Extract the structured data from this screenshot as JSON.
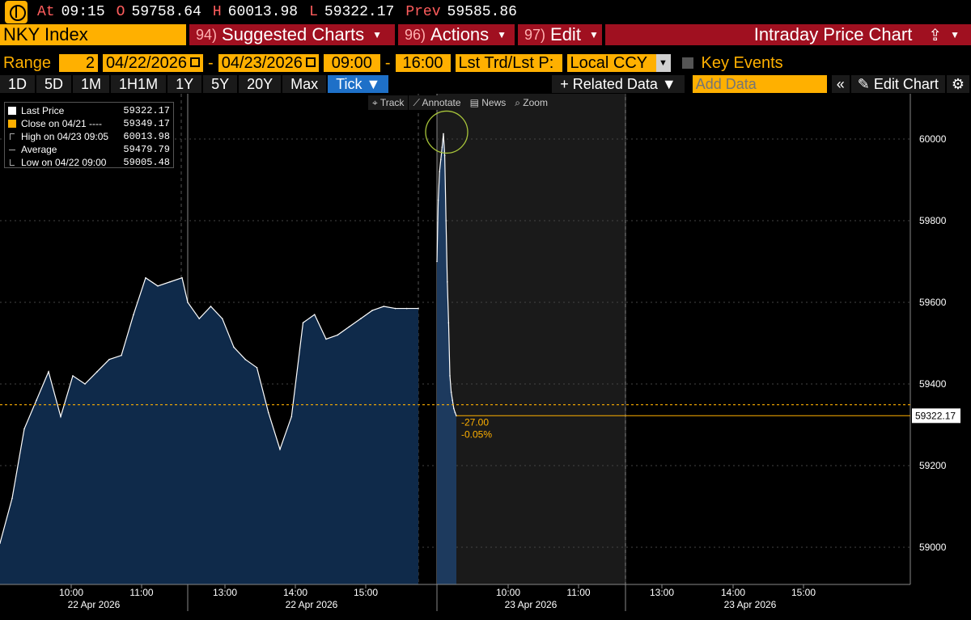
{
  "quote": {
    "at_label": "At",
    "at_value": "09:15",
    "o_label": "O",
    "o_value": "59758.64",
    "h_label": "H",
    "h_value": "60013.98",
    "l_label": "L",
    "l_value": "59322.17",
    "prev_label": "Prev",
    "prev_value": "59585.86"
  },
  "header": {
    "ticker": "NKY Index",
    "menus": [
      {
        "num": "94)",
        "label": "Suggested Charts"
      },
      {
        "num": "96)",
        "label": "Actions"
      },
      {
        "num": "97)",
        "label": "Edit"
      }
    ],
    "title": "Intraday Price Chart"
  },
  "range": {
    "label": "Range",
    "days": "2",
    "start_date": "04/22/2026",
    "end_date": "04/23/2026",
    "start_time": "09:00",
    "end_time": "16:00",
    "field": "Lst Trd/Lst P:",
    "currency": "Local CCY",
    "key_events": "Key Events"
  },
  "periods": [
    "1D",
    "5D",
    "1M",
    "1H1M",
    "1Y",
    "5Y",
    "20Y",
    "Max"
  ],
  "period_active": "Tick ▼",
  "toolbar": {
    "related_data": "+ Related Data ▼",
    "add_data_placeholder": "Add Data",
    "edit_chart": "Edit Chart"
  },
  "chart_tools": [
    "⌖ Track",
    "⟋ Annotate",
    "▤ News",
    "⌕ Zoom"
  ],
  "legend": [
    {
      "label": "Last Price",
      "value": "59322.17"
    },
    {
      "label": "Close on 04/21 ----",
      "value": "59349.17"
    },
    {
      "label": "High on 04/23 09:05",
      "value": "60013.98"
    },
    {
      "label": "Average",
      "value": "59479.79"
    },
    {
      "label": "Low on 04/22 09:00",
      "value": "59005.48"
    }
  ],
  "colors": {
    "orange": "#ffb000",
    "area_fill": "#0f2a4a",
    "area_fill_light": "#1d3a5e",
    "line": "#ffffff",
    "grid": "#444444",
    "circle": "#a8c53a"
  },
  "chart_data": {
    "type": "area",
    "title": "Intraday Price Chart",
    "ylim": [
      58900,
      60100
    ],
    "y_ticks": [
      59000,
      59200,
      59400,
      59600,
      59800,
      60000
    ],
    "x_tick_labels": [
      "10:00",
      "11:00",
      "13:00",
      "14:00",
      "15:00",
      "10:00",
      "11:00",
      "13:00",
      "14:00",
      "15:00"
    ],
    "x_date_labels": [
      "22 Apr 2026",
      "22 Apr 2026",
      "23 Apr 2026",
      "23 Apr 2026"
    ],
    "previous_close": 59349.17,
    "last_price": 59322.17,
    "last_price_label": "59322.17",
    "change_label": "-27.00",
    "change_pct_label": "-0.05%",
    "series": [
      {
        "session": "22 Apr 2026",
        "x": [
          "09:00",
          "09:10",
          "09:20",
          "09:30",
          "09:40",
          "09:50",
          "10:00",
          "10:10",
          "10:20",
          "10:30",
          "10:40",
          "10:50",
          "11:00",
          "11:10",
          "11:20",
          "11:30",
          "12:30",
          "12:40",
          "12:50",
          "13:00",
          "13:10",
          "13:20",
          "13:30",
          "13:40",
          "13:50",
          "14:00",
          "14:10",
          "14:20",
          "14:30",
          "14:40",
          "14:50",
          "15:00",
          "15:10",
          "15:20",
          "15:30",
          "15:40",
          "15:50"
        ],
        "values": [
          59010,
          59120,
          59290,
          59360,
          59430,
          59320,
          59420,
          59400,
          59430,
          59460,
          59470,
          59570,
          59660,
          59640,
          59650,
          59660,
          59600,
          59560,
          59590,
          59560,
          59490,
          59460,
          59440,
          59330,
          59240,
          59320,
          59550,
          59570,
          59510,
          59520,
          59540,
          59560,
          59580,
          59590,
          59585,
          59585,
          59585
        ]
      },
      {
        "session": "23 Apr 2026",
        "x": [
          "09:00",
          "09:01",
          "09:02",
          "09:03",
          "09:04",
          "09:05",
          "09:06",
          "09:07",
          "09:08",
          "09:09",
          "09:10",
          "09:11",
          "09:12",
          "09:13",
          "09:14",
          "09:15"
        ],
        "values": [
          59700,
          59850,
          59920,
          59950,
          59980,
          60013,
          59960,
          59800,
          59650,
          59550,
          59420,
          59380,
          59360,
          59340,
          59330,
          59322
        ]
      }
    ]
  }
}
